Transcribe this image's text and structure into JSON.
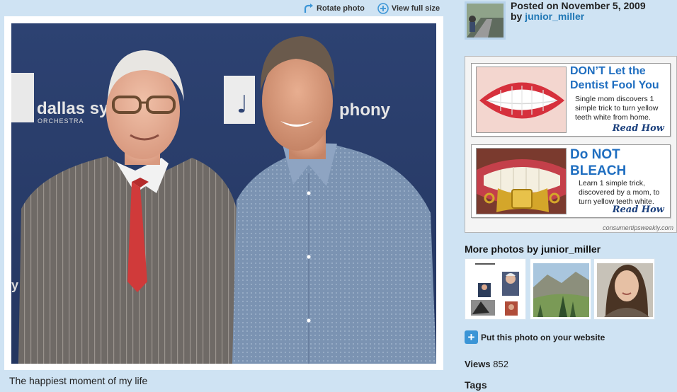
{
  "toolbar": {
    "rotate_label": "Rotate photo",
    "view_full_label": "View full size"
  },
  "photo": {
    "backdrop_text_left": "dallas sym",
    "backdrop_sub_left": "ORCHESTRA",
    "backdrop_text_right": "phony",
    "backdrop_partial_letter": "y",
    "caption": "The happiest moment of my life"
  },
  "post": {
    "posted_line": "Posted on November 5, 2009",
    "by_label": "by",
    "username": "junior_miller"
  },
  "ads": [
    {
      "headline_1": "DON’T Let the",
      "headline_2": "Dentist Fool You",
      "body": "Single mom discovers 1 simple trick to turn yellow teeth white from home.",
      "cta": "Read How"
    },
    {
      "headline_1": "Do NOT",
      "headline_2": "BLEACH",
      "body": "Learn 1 simple trick, discovered by a mom, to turn yellow teeth white.",
      "cta": "Read How"
    }
  ],
  "ad_source": "consumertipsweekly.com",
  "more_photos": {
    "title": "More photos by junior_miller"
  },
  "embed": {
    "label": "Put this photo on your website"
  },
  "stats": {
    "views_label": "Views",
    "views_value": "852",
    "tags_label": "Tags"
  },
  "colors": {
    "page_bg": "#cfe3f3",
    "link": "#1f77b5",
    "ad_headline": "#1f6ec0",
    "plus_button": "#3b95d6"
  }
}
